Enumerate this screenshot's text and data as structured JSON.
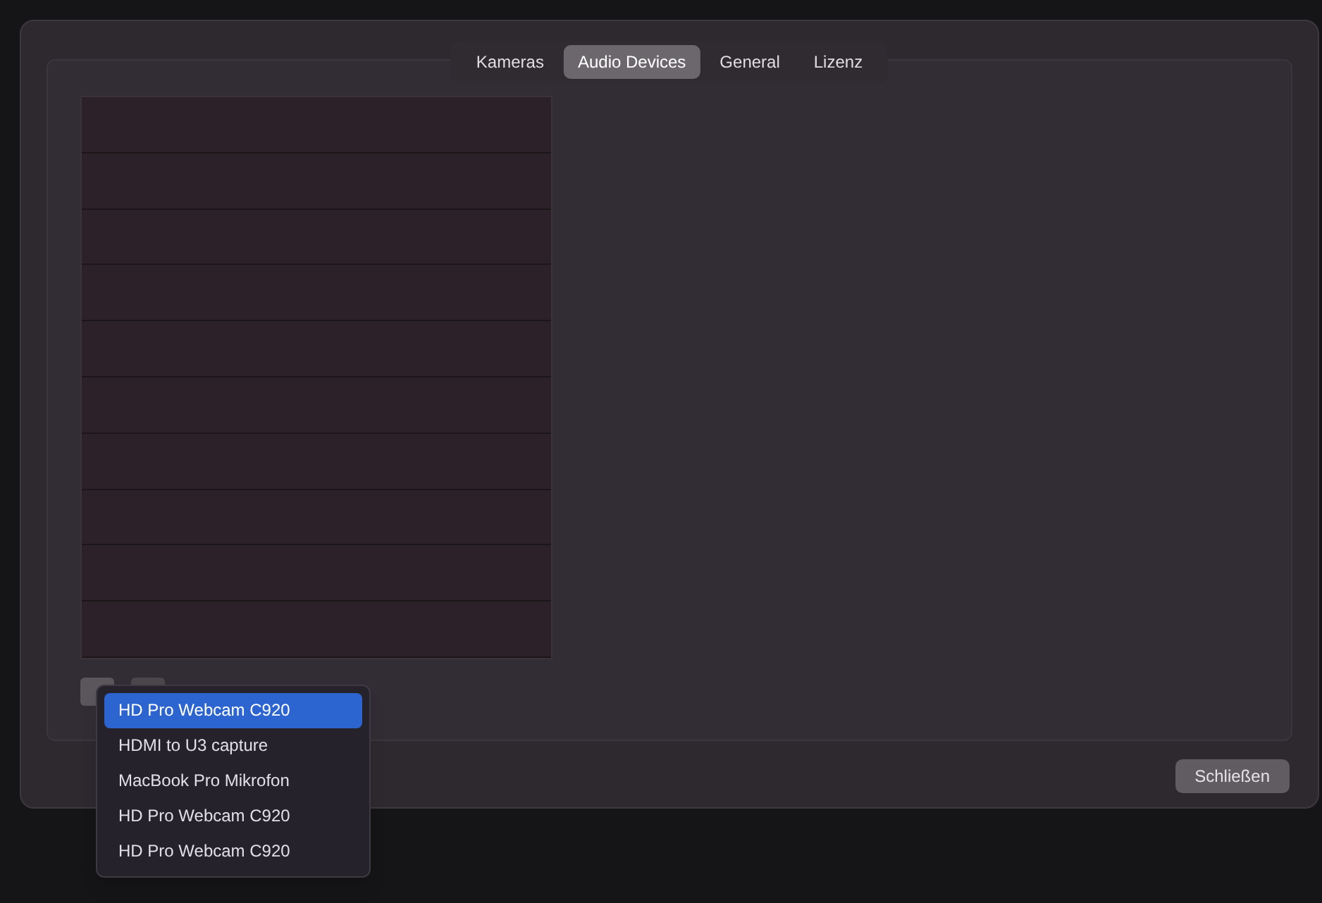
{
  "tabs": [
    {
      "label": "Kameras",
      "selected": false
    },
    {
      "label": "Audio Devices",
      "selected": true
    },
    {
      "label": "General",
      "selected": false
    },
    {
      "label": "Lizenz",
      "selected": false
    }
  ],
  "device_menu": {
    "items": [
      {
        "label": "HD Pro Webcam C920",
        "selected": true
      },
      {
        "label": "HDMI to U3 capture",
        "selected": false
      },
      {
        "label": "MacBook Pro Mikrofon",
        "selected": false
      },
      {
        "label": "HD Pro Webcam C920",
        "selected": false
      },
      {
        "label": "HD Pro Webcam C920",
        "selected": false
      }
    ]
  },
  "buttons": [
    "Schließen"
  ]
}
